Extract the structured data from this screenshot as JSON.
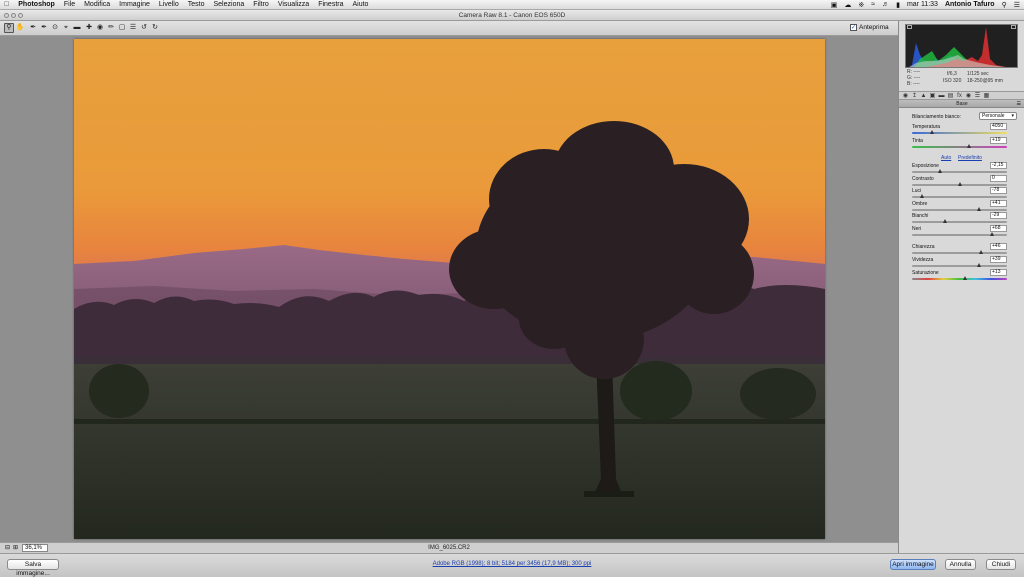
{
  "menubar": {
    "app": "Photoshop",
    "items": [
      "File",
      "Modifica",
      "Immagine",
      "Livello",
      "Testo",
      "Seleziona",
      "Filtro",
      "Visualizza",
      "Finestra",
      "Aiuto"
    ],
    "clock": "mar 11:33",
    "user": "Antonio Tafuro"
  },
  "window": {
    "title": "Camera Raw 8.1  -  Canon EOS 650D"
  },
  "toolbar": {
    "preview_label": "Anteprima",
    "preview_checked": true
  },
  "canvas": {
    "zoom": "36,1%",
    "filename": "IMG_6025.CR2"
  },
  "bottombar": {
    "save_label": "Salva immagine...",
    "workflow": "Adobe RGB (1998); 8 bit; 5184 per 3456 (17,9 MB); 300 ppi",
    "open_label": "Apri immagine",
    "cancel_label": "Annulla",
    "close_label": "Chiudi"
  },
  "info": {
    "r": "R:",
    "g": "G:",
    "b": "B:",
    "dashes": "----",
    "aperture": "f/6,3",
    "shutter": "1/125 sec",
    "iso": "ISO 320",
    "lens": "18-250@95 mm"
  },
  "panel": {
    "section": "Base",
    "wb_label": "Bilanciamento bianco:",
    "wb_value": "Personale",
    "auto": "Auto",
    "default": "Predefinito",
    "sliders": [
      {
        "label": "Temperatura",
        "value": "4050",
        "pos": 0.21
      },
      {
        "label": "Tinta",
        "value": "+19",
        "pos": 0.6
      },
      {
        "label": "Esposizione",
        "value": "-2,15",
        "pos": 0.29
      },
      {
        "label": "Contrasto",
        "value": "0",
        "pos": 0.5
      },
      {
        "label": "Luci",
        "value": "-78",
        "pos": 0.11
      },
      {
        "label": "Ombre",
        "value": "+41",
        "pos": 0.7
      },
      {
        "label": "Bianchi",
        "value": "-29",
        "pos": 0.35
      },
      {
        "label": "Neri",
        "value": "+68",
        "pos": 0.84
      },
      {
        "label": "Chiarezza",
        "value": "+46",
        "pos": 0.73
      },
      {
        "label": "Vividezza",
        "value": "+39",
        "pos": 0.7
      },
      {
        "label": "Saturazione",
        "value": "+13",
        "pos": 0.56
      }
    ]
  }
}
